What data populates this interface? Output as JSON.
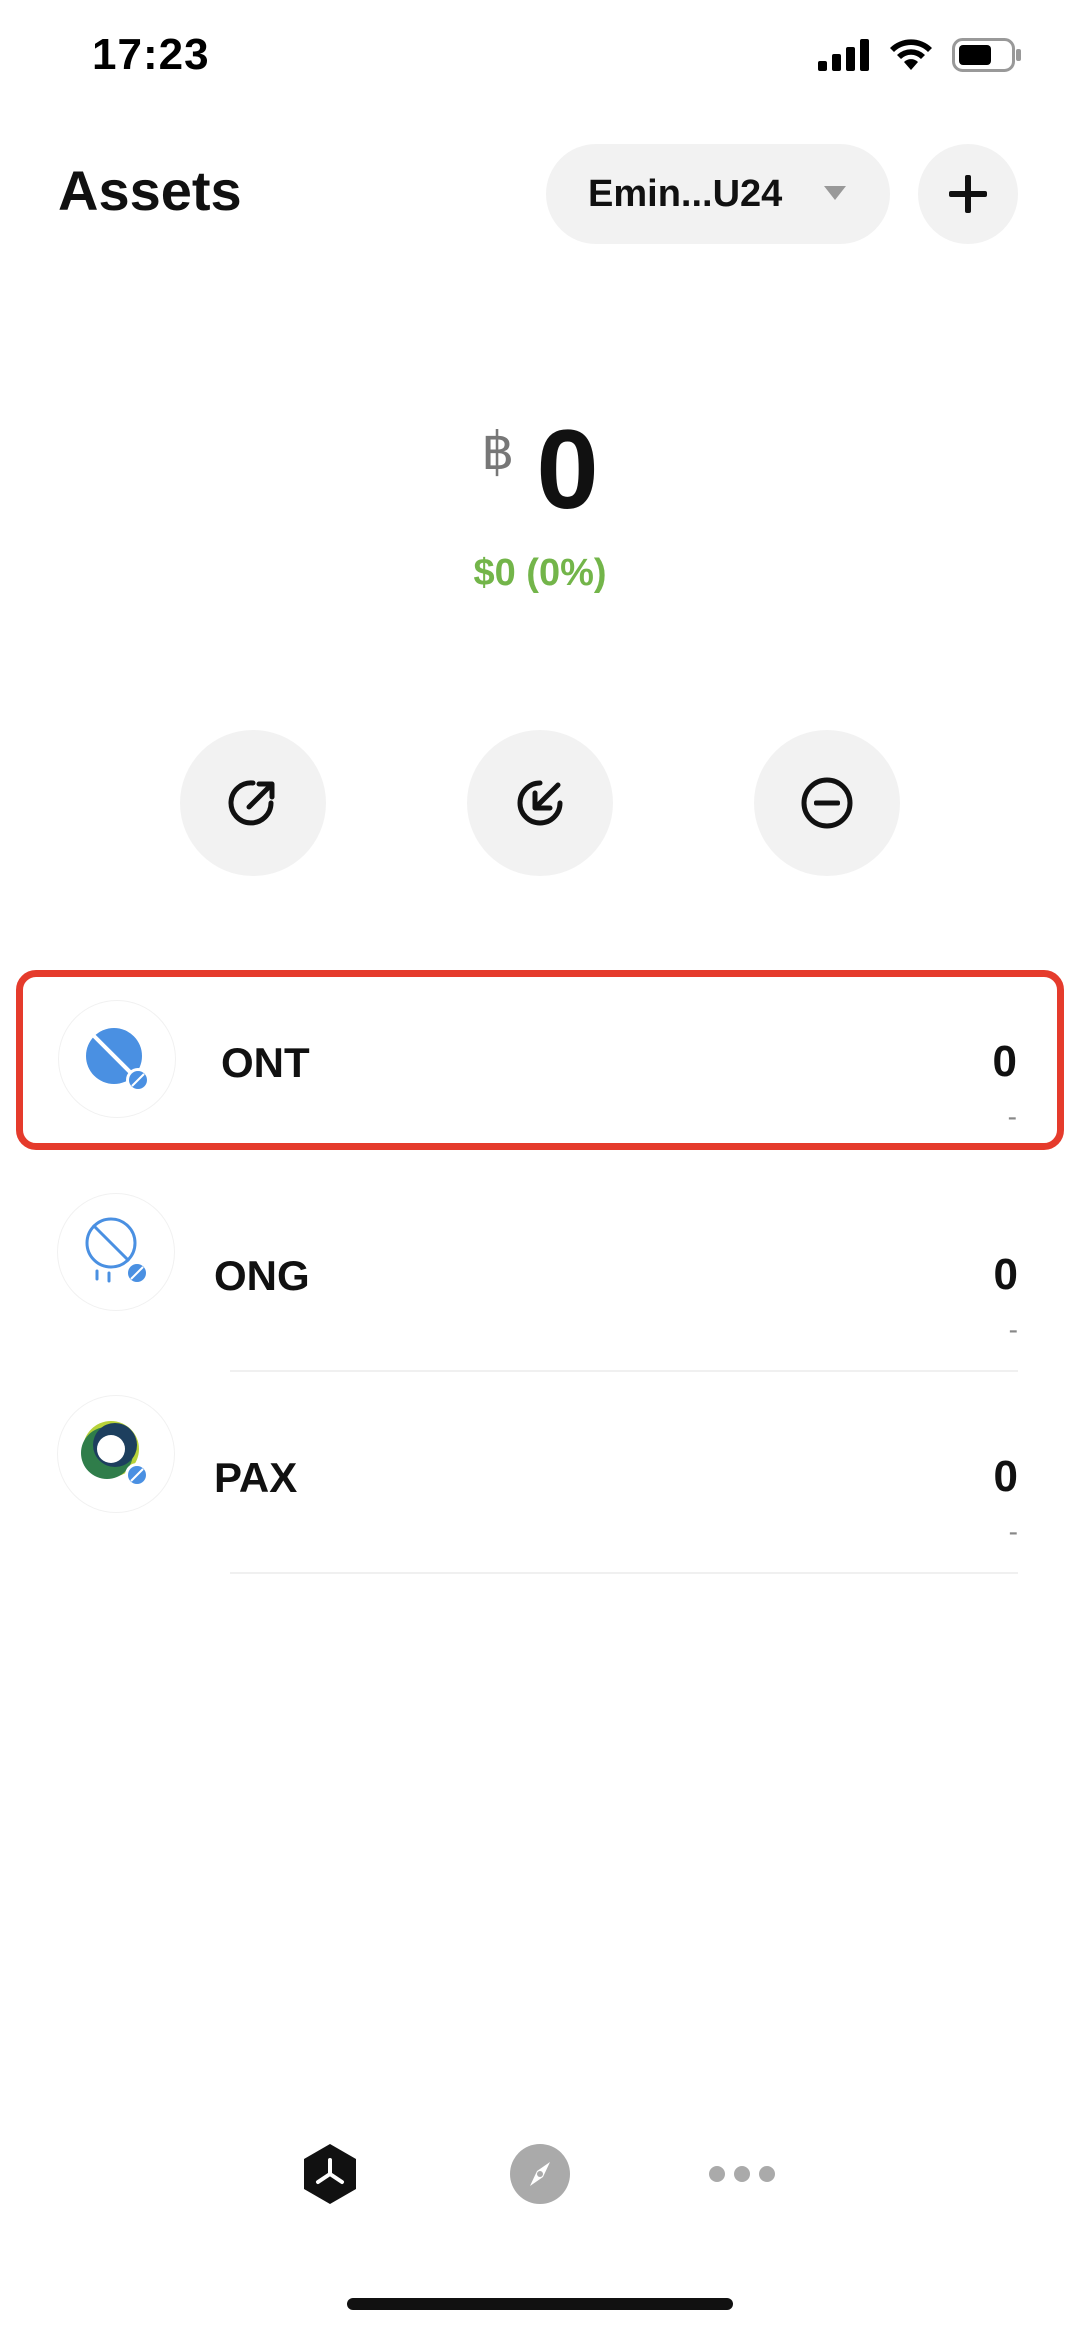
{
  "status_bar": {
    "time": "17:23"
  },
  "header": {
    "title": "Assets",
    "wallet_name": "Emin...U24"
  },
  "balance": {
    "currency_symbol": "฿",
    "amount": "0",
    "fiat_change": "$0 (0%)",
    "fiat_change_color": "#73b54a"
  },
  "actions": [
    {
      "name": "send",
      "icon": "send-arrow-up-right-icon"
    },
    {
      "name": "receive",
      "icon": "receive-arrow-down-left-icon"
    },
    {
      "name": "remove",
      "icon": "minus-circle-icon"
    }
  ],
  "assets": [
    {
      "symbol": "ONT",
      "amount": "0",
      "fiat": "-",
      "icon": "ont-icon",
      "highlighted": true
    },
    {
      "symbol": "ONG",
      "amount": "0",
      "fiat": "-",
      "icon": "ong-icon",
      "highlighted": false
    },
    {
      "symbol": "PAX",
      "amount": "0",
      "fiat": "-",
      "icon": "pax-icon",
      "highlighted": false
    }
  ],
  "bottom_nav": [
    {
      "name": "assets",
      "icon": "cube-icon",
      "active": true
    },
    {
      "name": "discover",
      "icon": "compass-icon",
      "active": false
    },
    {
      "name": "more",
      "icon": "more-dots-icon",
      "active": false
    }
  ],
  "colors": {
    "highlight": "#e53b2c",
    "token_blue": "#4a90e2",
    "button_bg": "#f2f2f2"
  }
}
